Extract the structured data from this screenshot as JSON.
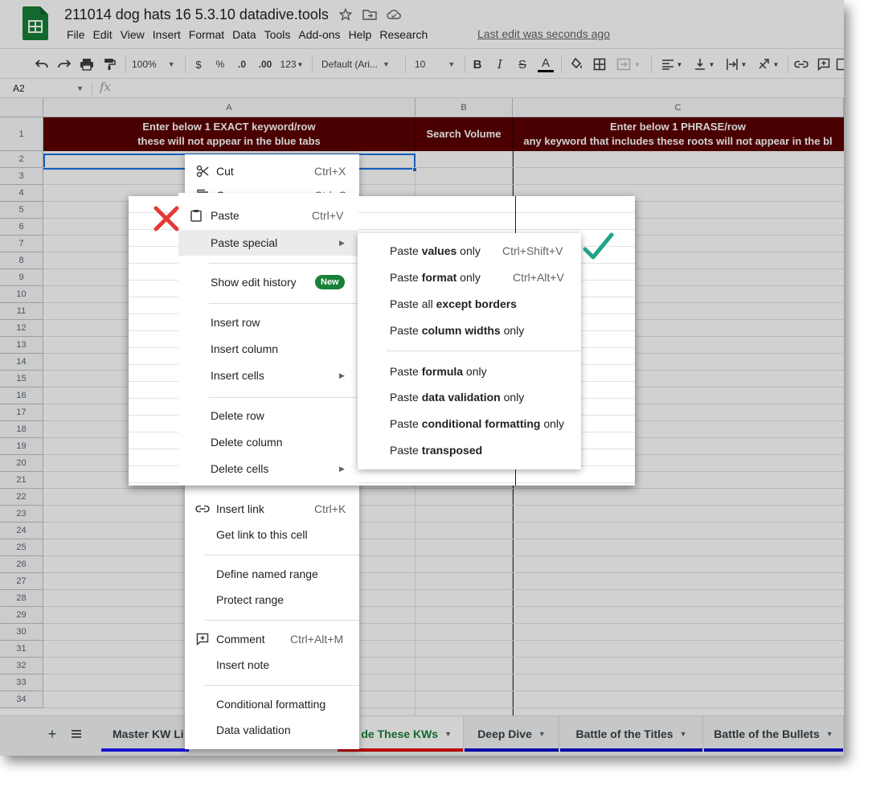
{
  "doc": {
    "title": "211014 dog hats 16 5.3.10 datadive.tools",
    "last_edit": "Last edit was seconds ago",
    "menu": [
      "File",
      "Edit",
      "View",
      "Insert",
      "Format",
      "Data",
      "Tools",
      "Add-ons",
      "Help",
      "Research"
    ]
  },
  "toolbar": {
    "zoom": "100%",
    "currency": "$",
    "percent": "%",
    "dec_decrease": ".0",
    "dec_increase": ".00",
    "more_formats": "123",
    "font": "Default (Ari...",
    "font_size": "10",
    "bold": "B",
    "italic": "I",
    "strike": "S",
    "text_color": "A"
  },
  "formula_bar": {
    "cell_ref": "A2",
    "fx": "fx"
  },
  "grid": {
    "columns": [
      "A",
      "B",
      "C"
    ],
    "rows": [
      "1",
      "2",
      "3",
      "4",
      "5",
      "6",
      "7",
      "8",
      "9",
      "10",
      "11",
      "12",
      "13",
      "14",
      "15",
      "16",
      "17",
      "18",
      "19",
      "20",
      "21",
      "22",
      "23",
      "24",
      "25",
      "26",
      "27",
      "28",
      "29",
      "30",
      "31",
      "32",
      "33",
      "34"
    ],
    "header_a_line1": "Enter below 1 EXACT keyword/row",
    "header_a_line2": "these will not appear in the blue tabs",
    "header_b": "Search Volume",
    "header_c_line1": "Enter below 1 PHRASE/row",
    "header_c_line2": "any keyword that includes these roots will not appear in the bl"
  },
  "sheet_tabs": [
    {
      "name": "Master KW Li",
      "color": "#1a1aff"
    },
    {
      "name": "de These KWs",
      "color": "#e00000"
    },
    {
      "name": "Deep Dive",
      "color": "#0000cc"
    },
    {
      "name": "Battle of the Titles",
      "color": "#0000cc"
    },
    {
      "name": "Battle of the Bullets",
      "color": "#0000cc"
    }
  ],
  "back_menu": {
    "cut": "Cut",
    "cut_sc": "Ctrl+X",
    "copy": "Copy",
    "copy_sc": "Ctrl+C",
    "insert_link": "Insert link",
    "insert_link_sc": "Ctrl+K",
    "get_link": "Get link to this cell",
    "define_range": "Define named range",
    "protect_range": "Protect range",
    "comment": "Comment",
    "comment_sc": "Ctrl+Alt+M",
    "insert_note": "Insert note",
    "conditional": "Conditional formatting",
    "validation": "Data validation"
  },
  "front_menu": {
    "paste": "Paste",
    "paste_sc": "Ctrl+V",
    "paste_special": "Paste special",
    "edit_history": "Show edit history",
    "new_badge": "New",
    "insert_row": "Insert row",
    "insert_column": "Insert column",
    "insert_cells": "Insert cells",
    "delete_row": "Delete row",
    "delete_column": "Delete column",
    "delete_cells": "Delete cells"
  },
  "submenu": {
    "values_a": "Paste ",
    "values_b": "values",
    "values_c": " only",
    "values_sc": "Ctrl+Shift+V",
    "format_a": "Paste ",
    "format_b": "format",
    "format_c": " only",
    "format_sc": "Ctrl+Alt+V",
    "borders_a": "Paste all ",
    "borders_b": "except borders",
    "widths_a": "Paste ",
    "widths_b": "column widths",
    "widths_c": " only",
    "formula_a": "Paste ",
    "formula_b": "formula",
    "formula_c": " only",
    "dv_a": "Paste ",
    "dv_b": "data validation",
    "dv_c": " only",
    "cf_a": "Paste ",
    "cf_b": "conditional formatting",
    "cf_c": " only",
    "trans_a": "Paste ",
    "trans_b": "transposed"
  },
  "colors": {
    "header_bg": "#5b0000",
    "accent_blue": "#1a73e8",
    "sheets_green": "#188038",
    "cross_red": "#e53935",
    "check_teal": "#1fa389"
  }
}
